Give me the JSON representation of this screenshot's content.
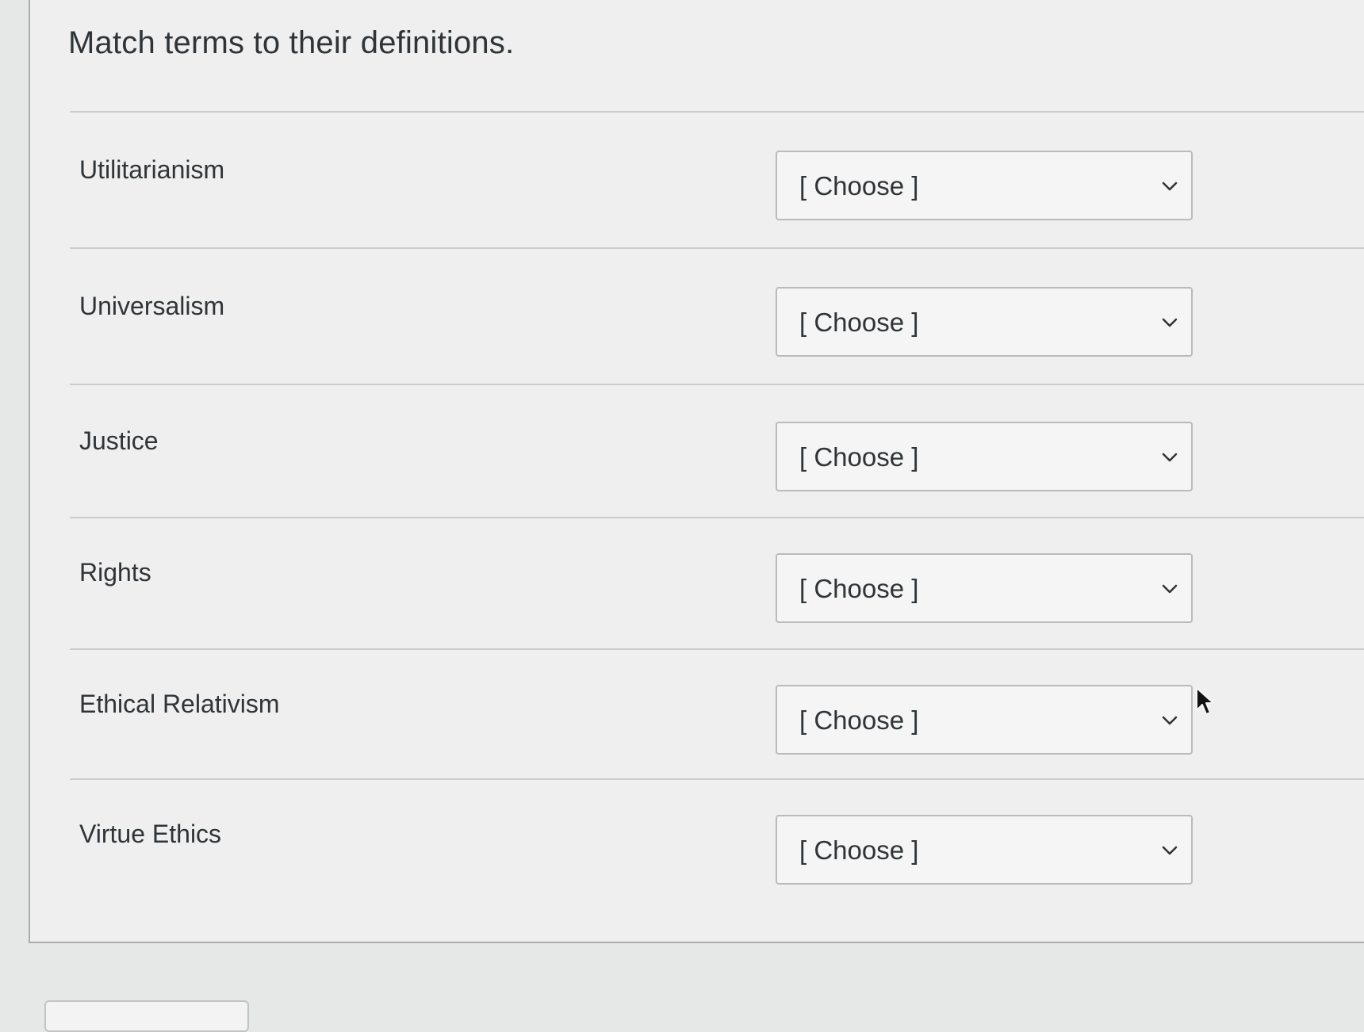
{
  "question": {
    "text": "Match terms to their definitions."
  },
  "rows": [
    {
      "term": "Utilitarianism",
      "selected": "[ Choose ]"
    },
    {
      "term": "Universalism",
      "selected": "[ Choose ]"
    },
    {
      "term": "Justice",
      "selected": "[ Choose ]"
    },
    {
      "term": "Rights",
      "selected": "[ Choose ]"
    },
    {
      "term": "Ethical Relativism",
      "selected": "[ Choose ]"
    },
    {
      "term": "Virtue Ethics",
      "selected": "[ Choose ]"
    }
  ],
  "icons": {
    "dropdown": "chevron-down-icon",
    "pointer": "mouse-pointer-icon"
  },
  "colors": {
    "text": "#2f3438",
    "panel": "#eeefee",
    "border": "#b8bcbd"
  }
}
